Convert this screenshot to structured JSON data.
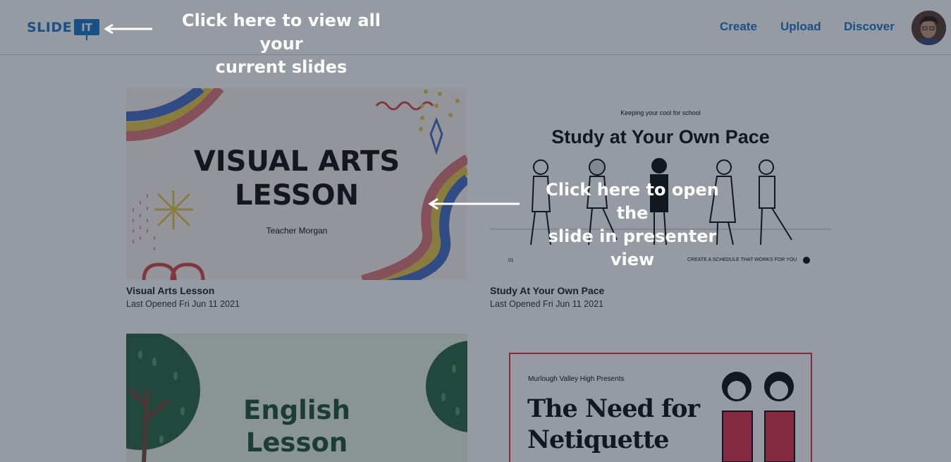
{
  "header": {
    "logo_word": "SLIDE",
    "logo_badge": "IT",
    "nav": [
      {
        "label": "Create"
      },
      {
        "label": "Upload"
      },
      {
        "label": "Discover"
      }
    ],
    "avatar_icon": "user-avatar",
    "brand_color": "#1e78c8"
  },
  "slides": [
    {
      "title": "Visual Arts Lesson",
      "last_opened": "Last Opened Fri Jun 11 2021",
      "thumb_title_1": "VISUAL ARTS",
      "thumb_title_2": "LESSON",
      "thumb_subtitle": "Teacher Morgan"
    },
    {
      "title": "Study At Your Own Pace",
      "last_opened": "Last Opened Fri Jun 11 2021",
      "thumb_kicker": "Keeping your cool for school",
      "thumb_title": "Study at Your Own Pace",
      "thumb_num": "01",
      "thumb_footer": "CREATE A SCHEDULE THAT WORKS FOR YOU"
    },
    {
      "thumb_title_1": "English",
      "thumb_title_2": "Lesson"
    },
    {
      "thumb_kicker": "Murlough Valley High Presents",
      "thumb_title_1": "The Need for",
      "thumb_title_2": "Netiquette"
    }
  ],
  "hints": {
    "slides_list_line1": "Click here to view all your",
    "slides_list_line2": "current slides",
    "presenter_line1": "Click here to open the",
    "presenter_line2": "slide in presenter view"
  }
}
